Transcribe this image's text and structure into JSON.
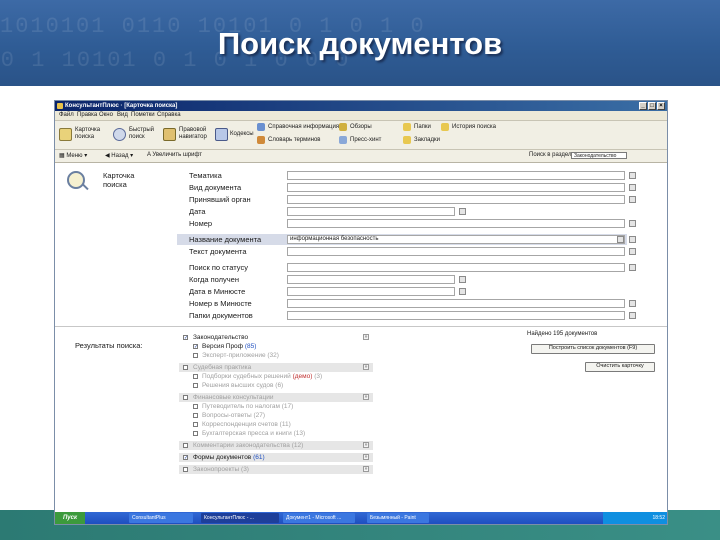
{
  "slide": {
    "title": "Поиск документов",
    "colors": {
      "header": "#2f5c95",
      "footer": "#2c7a73",
      "highlight_row": "#d6dbe8"
    }
  },
  "window": {
    "title": "КонсультантПлюс · [Карточка поиска]",
    "menu": [
      "Файл",
      "Правка",
      "Окно",
      "Вид",
      "Пометки",
      "Справка"
    ],
    "toolbar_main": [
      {
        "label": "Карточка поиска",
        "icon": "search-card-icon"
      },
      {
        "label": "Быстрый поиск",
        "icon": "quick-search-icon"
      },
      {
        "label": "Правовой навигатор",
        "icon": "navigator-icon"
      },
      {
        "label": "Кодексы",
        "icon": "codex-icon"
      },
      {
        "label": "Справочная информация",
        "icon": "reference-icon"
      },
      {
        "label": "Словарь терминов",
        "icon": "dictionary-icon"
      },
      {
        "label": "Обзоры",
        "icon": "reviews-icon"
      },
      {
        "label": "Пресс-хинт",
        "icon": "press-icon"
      },
      {
        "label": "Папки",
        "icon": "folder-icon"
      },
      {
        "label": "История поиска",
        "icon": "history-icon"
      },
      {
        "label": "Закладки",
        "icon": "bookmark-icon"
      }
    ],
    "toolbar_secondary": {
      "view": "Меню",
      "back": "Назад",
      "enlarge_font": "Увеличить шрифт",
      "search_in_section": "Поиск в разделе",
      "search_combo": "Законодательство"
    }
  },
  "search_card": {
    "title_line1": "Карточка",
    "title_line2": "поиска",
    "fields": [
      {
        "label": "Тематика",
        "value": ""
      },
      {
        "label": "Вид документа",
        "value": ""
      },
      {
        "label": "Принявший орган",
        "value": ""
      },
      {
        "label": "Дата",
        "value": ""
      },
      {
        "label": "Номер",
        "value": ""
      },
      {
        "label": "Название документа",
        "value": "информационная безопасность"
      },
      {
        "label": "Текст документа",
        "value": ""
      },
      {
        "label": "Поиск по статусу",
        "value": ""
      },
      {
        "label": "Когда получен",
        "value": ""
      },
      {
        "label": "Дата в Минюсте",
        "value": ""
      },
      {
        "label": "Номер в Минюсте",
        "value": ""
      },
      {
        "label": "Папки документов",
        "value": ""
      }
    ]
  },
  "results": {
    "title": "Результаты поиска:",
    "found_label": "Найдено 195 документов",
    "build_button": "Построить список документов (F9)",
    "clear_button": "Очистить карточку",
    "tree": [
      {
        "text": "Законодательство",
        "count": "",
        "checked": true,
        "level": 0,
        "dim": false,
        "header": true
      },
      {
        "text": "Версия Проф",
        "count": "(85)",
        "checked": true,
        "level": 1,
        "dim": false,
        "header": false
      },
      {
        "text": "Эксперт-приложение",
        "count": "(32)",
        "checked": false,
        "level": 1,
        "dim": true,
        "header": false
      },
      {
        "text": "Судебная практика",
        "count": "",
        "checked": false,
        "level": 0,
        "dim": true,
        "header": true
      },
      {
        "text": "Подборки судебных решений",
        "count": "(3)",
        "checked": false,
        "level": 1,
        "dim": true,
        "header": false,
        "extra": "(демо)"
      },
      {
        "text": "Решения высших судов",
        "count": "(6)",
        "checked": false,
        "level": 1,
        "dim": true,
        "header": false
      },
      {
        "text": "Финансовые консультации",
        "count": "",
        "checked": false,
        "level": 0,
        "dim": true,
        "header": true
      },
      {
        "text": "Путеводитель по налогам",
        "count": "(17)",
        "checked": false,
        "level": 1,
        "dim": true,
        "header": false
      },
      {
        "text": "Вопросы-ответы",
        "count": "(27)",
        "checked": false,
        "level": 1,
        "dim": true,
        "header": false
      },
      {
        "text": "Корреспонденция счетов",
        "count": "(11)",
        "checked": false,
        "level": 1,
        "dim": true,
        "header": false
      },
      {
        "text": "Бухгалтерская пресса и книги",
        "count": "(13)",
        "checked": false,
        "level": 1,
        "dim": true,
        "header": false
      },
      {
        "text": "Комментарии законодательства",
        "count": "(12)",
        "checked": false,
        "level": 0,
        "dim": true,
        "header": true
      },
      {
        "text": "Формы документов",
        "count": "(61)",
        "checked": true,
        "level": 0,
        "dim": false,
        "header": true
      },
      {
        "text": "Законопроекты",
        "count": "(3)",
        "checked": false,
        "level": 0,
        "dim": true,
        "header": true
      }
    ]
  },
  "taskbar": {
    "start": "Пуск",
    "tasks": [
      "ConsultantPlus",
      "КонсультантПлюс - ...",
      "Документ1 - Microsoft ...",
      "Безымянный - Paint"
    ],
    "clock": "18:52"
  }
}
